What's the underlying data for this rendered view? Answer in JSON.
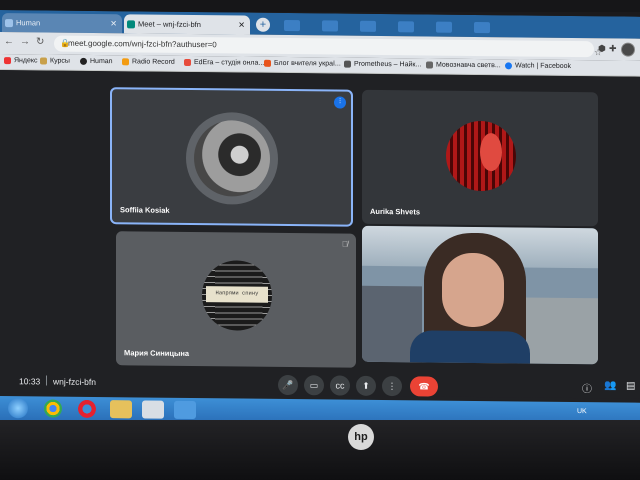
{
  "browser": {
    "tabs": [
      {
        "title": "Human",
        "active": false
      },
      {
        "title": "Meet – wnj-fzci-bfn",
        "active": true
      }
    ],
    "new_tab_label": "+",
    "url": "meet.google.com/wnj-fzci-bfn?authuser=0",
    "bookmarks": [
      "Яндекс",
      "Курсы",
      "Human",
      "Radio Record",
      "EdEra – студія онла...",
      "Блог вчителя украї...",
      "Prometheus – Найк...",
      "Мовознавча светв...",
      "Watch | Facebook"
    ]
  },
  "meet": {
    "participants": [
      {
        "name": "Soffiia Kosiak",
        "speaking": true
      },
      {
        "name": "Aurika Shvets",
        "speaking": false
      },
      {
        "name": "Мария Синицына",
        "muted": true,
        "avatar_caption": "Напрями спину"
      },
      {
        "name": "",
        "video": true
      }
    ],
    "time": "10:33",
    "separator": "|",
    "meeting_code": "wnj-fzci-bfn",
    "controls": [
      "mic-icon",
      "camera-icon",
      "captions-icon",
      "present-icon",
      "more-icon",
      "end-call-icon"
    ],
    "right_controls": [
      "info-icon",
      "people-icon",
      "chat-icon"
    ]
  },
  "os": {
    "tray_lang": "UK",
    "brand_logo": "hp"
  },
  "colors": {
    "tab_strip": "#25639e",
    "meet_bg": "#202124",
    "tile_bg": "#3c4043",
    "speaking_border": "#8ab4f8",
    "end_call": "#ea4335"
  }
}
